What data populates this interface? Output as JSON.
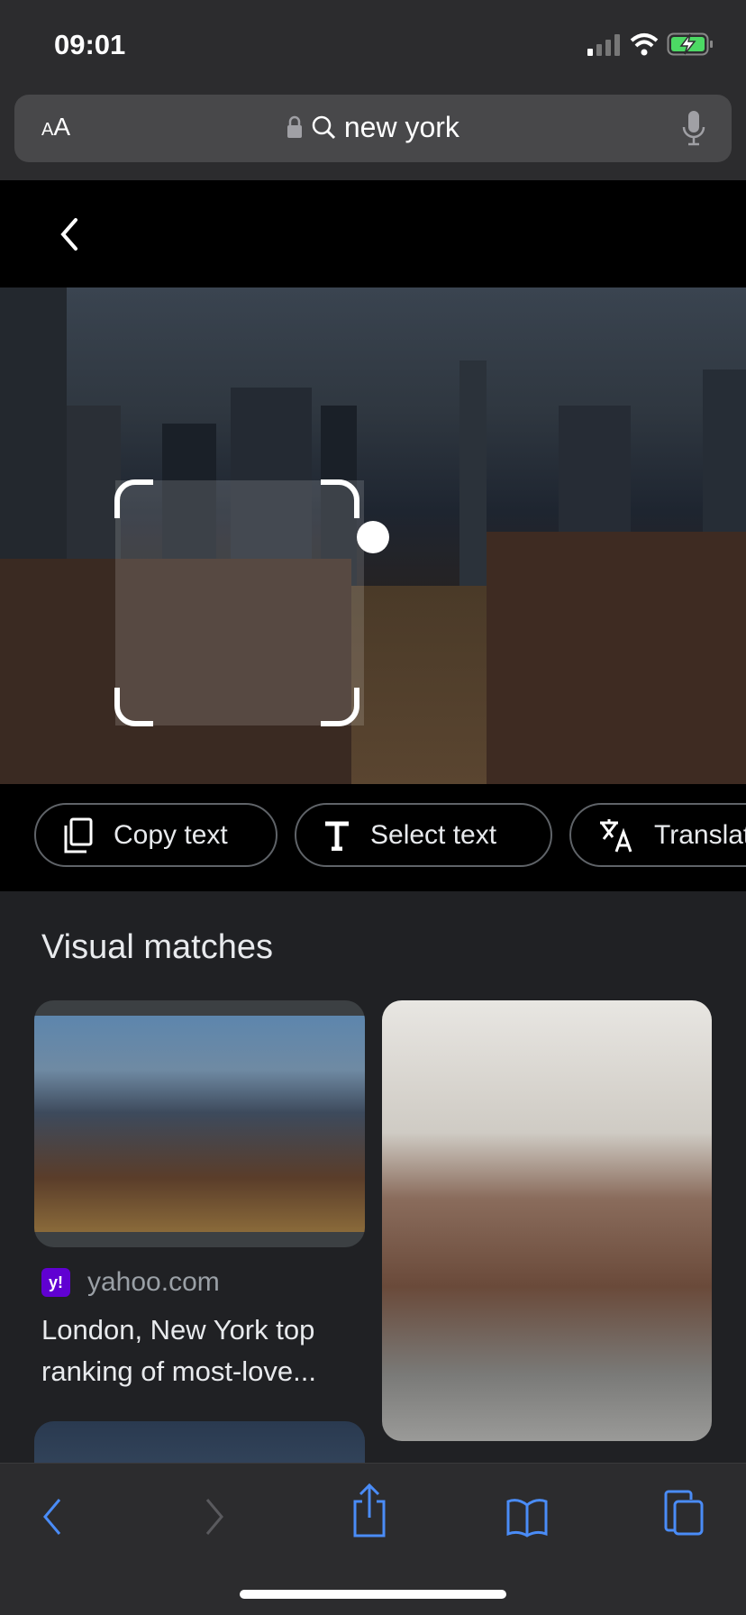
{
  "status_bar": {
    "time": "09:01",
    "battery_color": "#4cd964"
  },
  "url_bar": {
    "text_size_label_small": "A",
    "text_size_label_large": "A",
    "query": "new york",
    "lock_icon": "lock-icon",
    "search_icon": "search-icon",
    "mic_icon": "microphone-icon"
  },
  "lens": {
    "back_icon": "chevron-left-icon"
  },
  "chips": [
    {
      "label": "Copy text",
      "icon": "copy-icon"
    },
    {
      "label": "Select text",
      "icon": "text-icon"
    },
    {
      "label": "Translate",
      "icon": "translate-icon"
    }
  ],
  "visual_matches": {
    "heading": "Visual matches",
    "results": [
      {
        "source": "yahoo.com",
        "favicon_label": "y!",
        "favicon_color": "#6001d2",
        "title_line1": "London, New York top",
        "title_line2": "ranking of most-love..."
      }
    ]
  },
  "toolbar": {
    "back_icon": "chevron-left-icon",
    "forward_icon": "chevron-right-icon",
    "share_icon": "share-icon",
    "bookmarks_icon": "book-icon",
    "tabs_icon": "tabs-icon",
    "accent": "#4a8cf7"
  }
}
